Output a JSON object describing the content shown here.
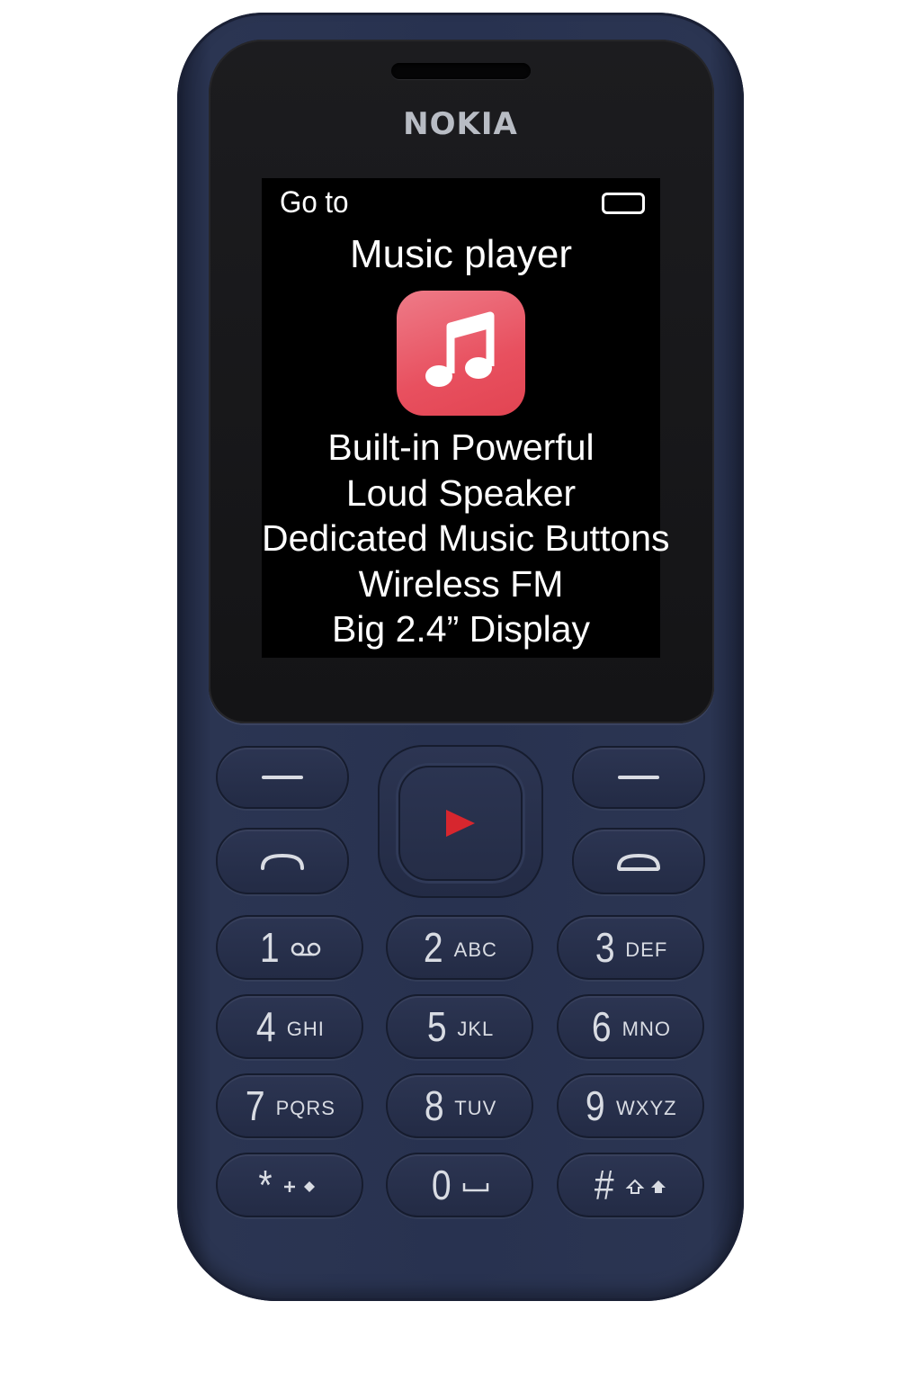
{
  "brand": "NOKIA",
  "screen": {
    "status_label": "Go to",
    "battery_icon": "battery-icon",
    "title": "Music player",
    "app_icon": "music-note-icon",
    "app_icon_color": "#e8505f",
    "features": [
      "Built-in Powerful",
      "Loud Speaker",
      "Dedicated Music Buttons",
      "Wireless FM",
      "Big 2.4” Display"
    ]
  },
  "colors": {
    "body": "#283250",
    "screen_bg": "#000000",
    "play_accent": "#d7262e"
  },
  "keypad": {
    "soft_left_icon": "dash-icon",
    "soft_right_icon": "dash-icon",
    "call_icon": "call-icon",
    "end_icon": "end-call-icon",
    "center_icon": "play-icon",
    "keys": [
      {
        "digit": "1",
        "letters": "",
        "icon": "voicemail-icon"
      },
      {
        "digit": "2",
        "letters": "ABC"
      },
      {
        "digit": "3",
        "letters": "DEF"
      },
      {
        "digit": "4",
        "letters": "GHI"
      },
      {
        "digit": "5",
        "letters": "JKL"
      },
      {
        "digit": "6",
        "letters": "MNO"
      },
      {
        "digit": "7",
        "letters": "PQRS"
      },
      {
        "digit": "8",
        "letters": "TUV"
      },
      {
        "digit": "9",
        "letters": "WXYZ"
      },
      {
        "digit": "*",
        "letters": "",
        "icon": "plus-diamond-icon"
      },
      {
        "digit": "0",
        "letters": "",
        "icon": "space-icon"
      },
      {
        "digit": "#",
        "letters": "",
        "icon": "shift-icon"
      }
    ]
  }
}
